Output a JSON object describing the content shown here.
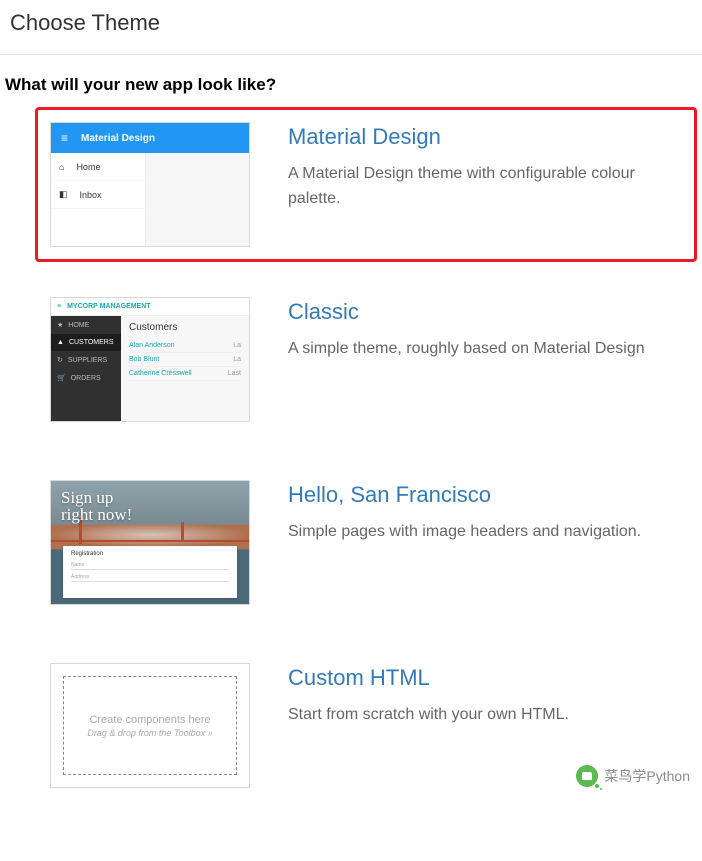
{
  "header": {
    "title": "Choose Theme"
  },
  "subtitle": "What will your new app look like?",
  "themes": [
    {
      "title": "Material Design",
      "desc": "A Material Design theme with configurable colour palette.",
      "selected": true,
      "preview": {
        "header_label": "Material Design",
        "nav_items": [
          "Home",
          "Inbox"
        ]
      }
    },
    {
      "title": "Classic",
      "desc": "A simple theme, roughly based on Material Design",
      "selected": false,
      "preview": {
        "brand": "MYCORP MANAGEMENT",
        "side_items": [
          "HOME",
          "CUSTOMERS",
          "SUPPLIERS",
          "ORDERS"
        ],
        "panel_title": "Customers",
        "rows": [
          {
            "name": "Alan Anderson",
            "meta": "La"
          },
          {
            "name": "Bob Blunt",
            "meta": "La"
          },
          {
            "name": "Catherine Cresswell",
            "meta": "Last"
          }
        ]
      }
    },
    {
      "title": "Hello, San Francisco",
      "desc": "Simple pages with image headers and navigation.",
      "selected": false,
      "preview": {
        "hero_line1": "Sign up",
        "hero_line2": "right now!",
        "form_title": "Registration",
        "field_labels": [
          "Name",
          "Address"
        ]
      }
    },
    {
      "title": "Custom HTML",
      "desc": "Start from scratch with your own HTML.",
      "selected": false,
      "preview": {
        "line1": "Create components here",
        "line2": "Drag & drop from the Toolbox »"
      }
    }
  ],
  "watermark": "菜鸟学Python"
}
